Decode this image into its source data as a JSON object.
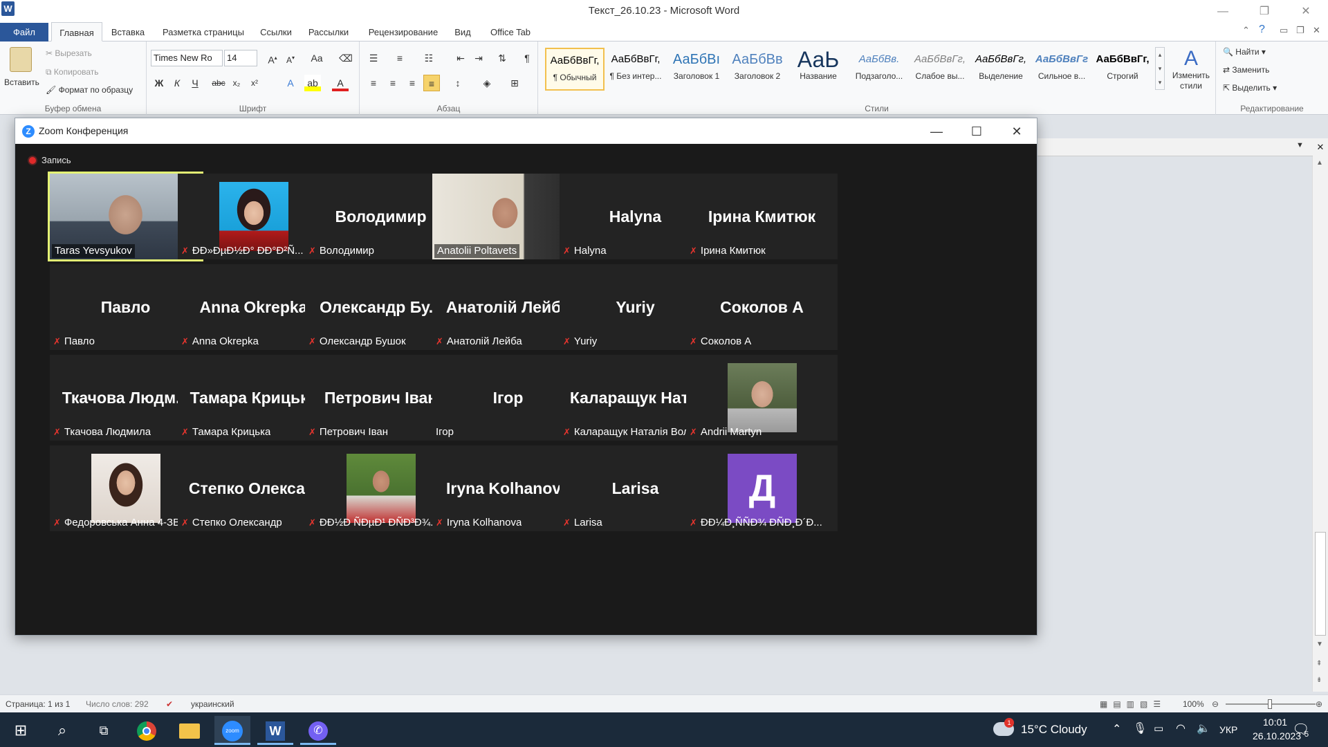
{
  "word": {
    "title": "Текст_26.10.23 - Microsoft Word",
    "logo": "W",
    "window_controls": {
      "minimize": "—",
      "restore": "❐",
      "close": "✕"
    },
    "tabs": [
      "Файл",
      "Главная",
      "Вставка",
      "Разметка страницы",
      "Ссылки",
      "Рассылки",
      "Рецензирование",
      "Вид",
      "Office Tab"
    ],
    "active_tab": "Главная",
    "clipboard": {
      "paste": "Вставить",
      "cut": "Вырезать",
      "copy": "Копировать",
      "format_painter": "Формат по образцу",
      "group": "Буфер обмена"
    },
    "font": {
      "name": "Times New Ro",
      "size": "14",
      "group": "Шрифт"
    },
    "paragraph": {
      "group": "Абзац"
    },
    "styles": {
      "group": "Стили",
      "items": [
        {
          "sample": "АаБбВвГг,",
          "name": "¶ Обычный",
          "color": "#000"
        },
        {
          "sample": "АаБбВвГг,",
          "name": "¶ Без интер...",
          "color": "#000"
        },
        {
          "sample": "АаБбВı",
          "name": "Заголовок 1",
          "color": "#2e74b5"
        },
        {
          "sample": "АаБбВв",
          "name": "Заголовок 2",
          "color": "#4f81bd"
        },
        {
          "sample": "АаЬ",
          "name": "Название",
          "color": "#17365d"
        },
        {
          "sample": "АаБбВв.",
          "name": "Подзаголо...",
          "color": "#4f81bd"
        },
        {
          "sample": "АаБбВвГг,",
          "name": "Слабое вы...",
          "color": "#808080"
        },
        {
          "sample": "АаБбВвГг,",
          "name": "Выделение",
          "color": "#000"
        },
        {
          "sample": "АаБбВвГг",
          "name": "Сильное в...",
          "color": "#4f81bd"
        },
        {
          "sample": "АаБбВвГг,",
          "name": "Строгий",
          "color": "#000"
        }
      ],
      "change_styles": "Изменить стили"
    },
    "editing": {
      "group": "Редактирование",
      "find": "Найти",
      "replace": "Заменить",
      "select": "Выделить"
    },
    "status": {
      "page": "Страница: 1 из 1",
      "words": "Число слов: 292",
      "language": "украинский",
      "zoom": "100%"
    }
  },
  "zoom": {
    "title": "Zoom Конференция",
    "recording": "Запись",
    "participants": [
      {
        "big": "",
        "label": "Taras Yevsyukov",
        "muted": false,
        "video": "wide",
        "speaking": true
      },
      {
        "big": "",
        "label": "ÐÐ»ÐµÐ½Ð° ÐÐ°Ð²Ñ...",
        "muted": true,
        "video": "photo-woman"
      },
      {
        "big": "Володимир",
        "label": "Володимир",
        "muted": true
      },
      {
        "big": "",
        "label": "Anatolii Poltavets",
        "muted": false,
        "video": "wide2"
      },
      {
        "big": "Halyna",
        "label": "Halyna",
        "muted": true
      },
      {
        "big": "Ірина Кмитюк",
        "label": "Ірина Кмитюк",
        "muted": true
      },
      {
        "big": "Павло",
        "label": "Павло",
        "muted": true
      },
      {
        "big": "Anna Okrepka",
        "label": "Anna Okrepka",
        "muted": true
      },
      {
        "big": "Олександр Бу...",
        "label": "Олександр Бушок",
        "muted": true
      },
      {
        "big": "Анатолій Лейба",
        "label": "Анатолій Лейба",
        "muted": true
      },
      {
        "big": "Yuriy",
        "label": "Yuriy",
        "muted": true
      },
      {
        "big": "Соколов А",
        "label": "Соколов А",
        "muted": true
      },
      {
        "big": "Ткачова Людм...",
        "label": "Ткачова Людмила",
        "muted": true
      },
      {
        "big": "Тамара Крицька",
        "label": "Тамара Крицька",
        "muted": true
      },
      {
        "big": "Петрович Іван",
        "label": "Петрович Іван",
        "muted": true
      },
      {
        "big": "Ігор",
        "label": "Ігор",
        "muted": false
      },
      {
        "big": "Каларащук Нат...",
        "label": "Каларащук Наталія Воло...",
        "muted": true
      },
      {
        "big": "",
        "label": "Andrii Martyn",
        "muted": true,
        "video": "photo-man"
      },
      {
        "big": "",
        "label": "Федоровська Анна 4-ЗВ-2",
        "muted": true,
        "video": "photo-girl"
      },
      {
        "big": "Степко Олекса...",
        "label": "Степко Олександр",
        "muted": true
      },
      {
        "big": "",
        "label": "ÐÐ½Ð ÑÐµÐ¹ ÐÑÐ³Ð¾...",
        "muted": true,
        "video": "photo-man2"
      },
      {
        "big": "Iryna Kolhanova",
        "label": "Iryna Kolhanova",
        "muted": true
      },
      {
        "big": "Larisa",
        "label": "Larisa",
        "muted": true
      },
      {
        "big": "",
        "label": "ÐÐ¼Ð¸ÑÑÐ¾ ÐÑÐ¸Ð´Ð...",
        "muted": true,
        "video": "letter",
        "letter": "Д"
      }
    ]
  },
  "taskbar": {
    "weather": "15°C  Cloudy",
    "weather_badge": "1",
    "lang": "УКР",
    "time": "10:01",
    "date": "26.10.2023",
    "notif": "5",
    "zoom_label": "zoom"
  }
}
